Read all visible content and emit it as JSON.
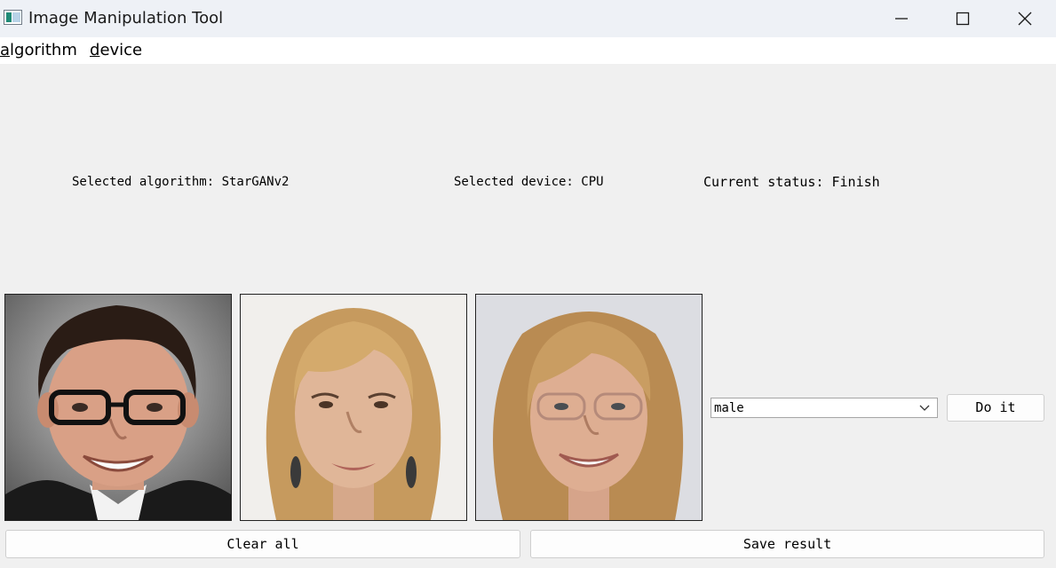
{
  "window": {
    "title": "Image Manipulation Tool",
    "app_icon": "app-window-icon",
    "controls": [
      "minimize-icon",
      "maximize-icon",
      "close-icon"
    ]
  },
  "menu": {
    "algorithm": {
      "mnemonic": "a",
      "rest": "lgorithm"
    },
    "device": {
      "mnemonic": "d",
      "rest": "evice"
    }
  },
  "status": {
    "algorithm_label": "Selected algorithm: StarGANv2",
    "device_label": "Selected device: CPU",
    "status_label": "Current status: Finish"
  },
  "images": [
    {
      "name": "source-image",
      "icon": "portrait-photo"
    },
    {
      "name": "reference-image",
      "icon": "portrait-photo"
    },
    {
      "name": "result-image",
      "icon": "portrait-photo"
    }
  ],
  "controls": {
    "attribute_select": {
      "value": "male",
      "icon": "chevron-down-icon"
    },
    "do_it_label": "Do it",
    "clear_all_label": "Clear all",
    "save_result_label": "Save result"
  },
  "colors": {
    "window_bg": "#f0f0f0",
    "titlebar_bg": "#eef1f6",
    "menubar_bg": "#ffffff"
  }
}
